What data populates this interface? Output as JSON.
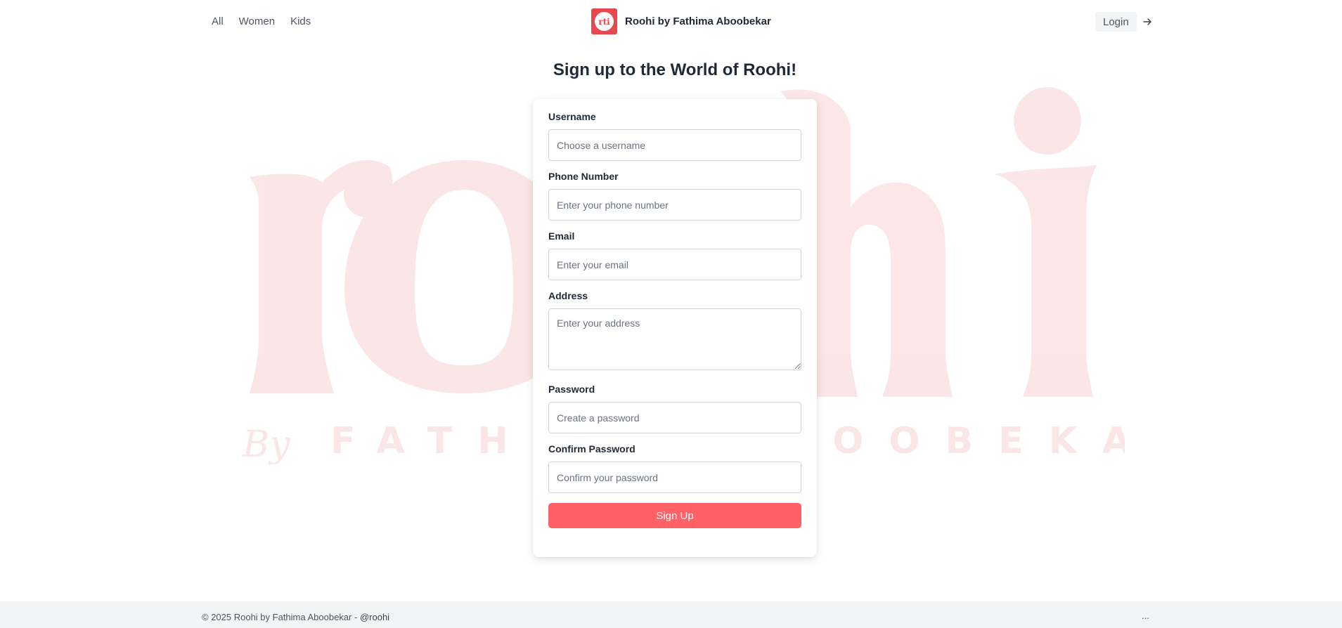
{
  "header": {
    "nav": [
      {
        "label": "All"
      },
      {
        "label": "Women"
      },
      {
        "label": "Kids"
      }
    ],
    "brand": {
      "logo_text": "rti",
      "name": "Roohi by Fathima Aboobekar"
    },
    "login_label": "Login",
    "login_icon": "arrow-right-icon"
  },
  "watermark": {
    "word": "roohi",
    "by": "By",
    "tagline": "FATHIMA ABOOBEKAR",
    "color": "#f8d7d7"
  },
  "page_title": "Sign up to the World of Roohi!",
  "form": {
    "fields": [
      {
        "label": "Username",
        "placeholder": "Choose a username"
      },
      {
        "label": "Phone Number",
        "placeholder": "Enter your phone number"
      },
      {
        "label": "Email",
        "placeholder": "Enter your email"
      },
      {
        "label": "Address",
        "placeholder": "Enter your address"
      },
      {
        "label": "Password",
        "placeholder": "Create a password"
      },
      {
        "label": "Confirm Password",
        "placeholder": "Confirm your password"
      }
    ],
    "submit_label": "Sign Up",
    "accent_color": "#ff6167"
  },
  "footer": {
    "copyright": "© 2025 Roohi by Fathima Aboobekar -",
    "handle": "@roohi",
    "more": "..."
  }
}
